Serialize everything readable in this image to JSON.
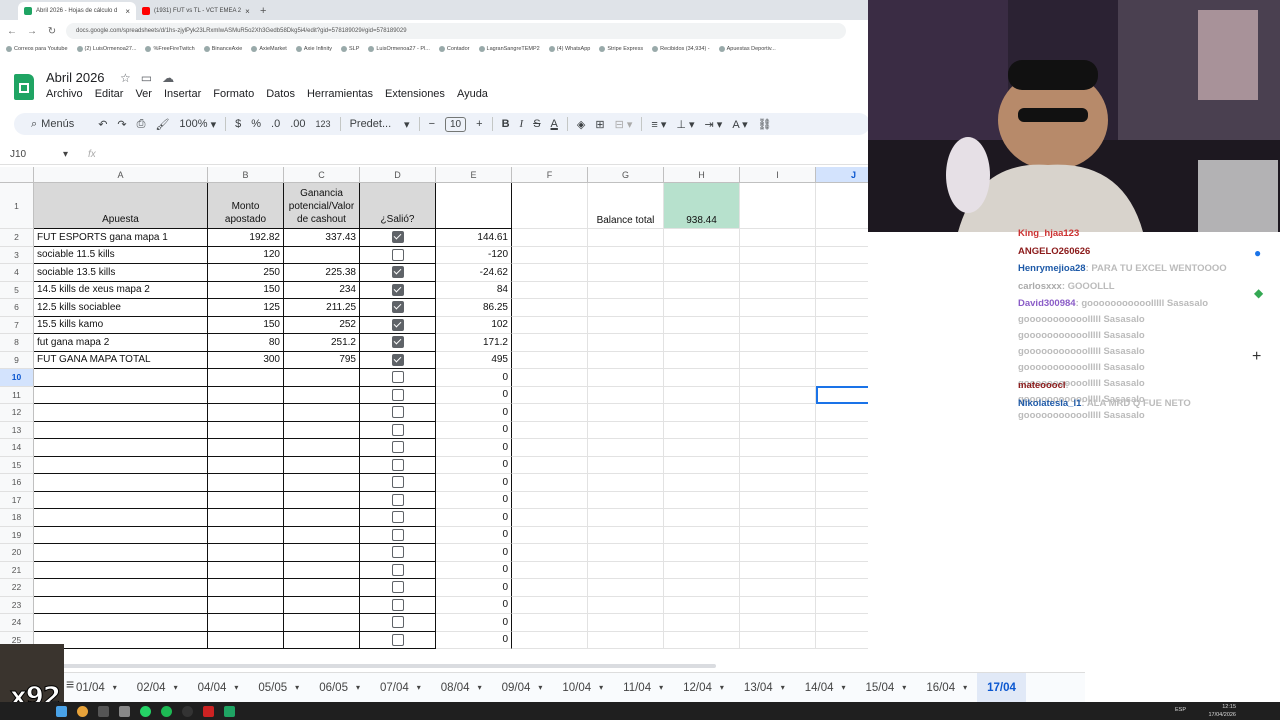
{
  "browser": {
    "tabs": [
      {
        "title": "Abril 2026 - Hojas de cálculo d",
        "active": true,
        "color": "#1fa463"
      },
      {
        "title": "(1931) FUT vs TL - VCT EMEA 2",
        "active": false,
        "color": "#ff0000"
      }
    ],
    "url": "docs.google.com/spreadsheets/d/1hs-zjylPyk23LRxmlwASMuR5o2Xh3Gedb58Dkg5i4/edit?gid=578189029#gid=578189029",
    "bookmarks": [
      "Correos para Youtube",
      "(2) LuisOrmenoa27...",
      "%FreeFireTwitch",
      "BinanceAxie",
      "AxieMarket",
      "Axie Infinity",
      "SLP",
      "LuisOrmenoa27 - Pl...",
      "Contador",
      "LagranSangreTEMP2",
      "(4) WhatsApp",
      "Stripe Express",
      "Recibidos (34,934) -",
      "Apuestas Deportiv..."
    ]
  },
  "doc": {
    "title": "Abril 2026",
    "menu": [
      "Archivo",
      "Editar",
      "Ver",
      "Insertar",
      "Formato",
      "Datos",
      "Herramientas",
      "Extensiones",
      "Ayuda"
    ]
  },
  "toolbar": {
    "search": "Menús",
    "zoom": "100%",
    "currency": "$",
    "percent": "%",
    "dec_less": ".0",
    "dec_more": ".00",
    "number_format": "123",
    "font": "Predet...",
    "font_size": "10",
    "bold": "B",
    "italic": "I",
    "strike": "S",
    "text_color": "A"
  },
  "formula_bar": {
    "name_box": "J10",
    "fx": "fx"
  },
  "columns": [
    "A",
    "B",
    "C",
    "D",
    "E",
    "F",
    "G",
    "H",
    "I",
    "J"
  ],
  "selected_column": "J",
  "headers": {
    "A": "Apuesta",
    "B": "Monto apostado",
    "C": "Ganancia potencial/Valor de cashout",
    "D": "¿Salió?"
  },
  "balance": {
    "label": "Balance total",
    "value": "938.44",
    "color": "#b7e1cd"
  },
  "row_numbers": [
    "1",
    "2",
    "3",
    "4",
    "5",
    "6",
    "7",
    "8",
    "9",
    "10",
    "11",
    "12",
    "13",
    "14",
    "15",
    "16",
    "17",
    "18",
    "19",
    "20",
    "21",
    "22",
    "23",
    "24",
    "25"
  ],
  "selected_row": "10",
  "rows": [
    {
      "apuesta": "FUT ESPORTS gana mapa 1",
      "monto": "192.82",
      "ganancia": "337.43",
      "salio": true,
      "resultado": "144.61"
    },
    {
      "apuesta": "sociable 11.5 kills",
      "monto": "120",
      "ganancia": "",
      "salio": false,
      "resultado": "-120"
    },
    {
      "apuesta": "sociable 13.5 kills",
      "monto": "250",
      "ganancia": "225.38",
      "salio": true,
      "resultado": "-24.62"
    },
    {
      "apuesta": "14.5 kills de xeus mapa 2",
      "monto": "150",
      "ganancia": "234",
      "salio": true,
      "resultado": "84"
    },
    {
      "apuesta": "12.5 kills sociablee",
      "monto": "125",
      "ganancia": "211.25",
      "salio": true,
      "resultado": "86.25"
    },
    {
      "apuesta": "15.5 kills kamo",
      "monto": "150",
      "ganancia": "252",
      "salio": true,
      "resultado": "102"
    },
    {
      "apuesta": "fut gana mapa 2",
      "monto": "80",
      "ganancia": "251.2",
      "salio": true,
      "resultado": "171.2"
    },
    {
      "apuesta": "FUT GANA MAPA TOTAL",
      "monto": "300",
      "ganancia": "795",
      "salio": true,
      "resultado": "495"
    },
    {
      "apuesta": "",
      "monto": "",
      "ganancia": "",
      "salio": false,
      "resultado": "0"
    },
    {
      "apuesta": "",
      "monto": "",
      "ganancia": "",
      "salio": false,
      "resultado": "0"
    },
    {
      "apuesta": "",
      "monto": "",
      "ganancia": "",
      "salio": false,
      "resultado": "0"
    },
    {
      "apuesta": "",
      "monto": "",
      "ganancia": "",
      "salio": false,
      "resultado": "0"
    },
    {
      "apuesta": "",
      "monto": "",
      "ganancia": "",
      "salio": false,
      "resultado": "0"
    },
    {
      "apuesta": "",
      "monto": "",
      "ganancia": "",
      "salio": false,
      "resultado": "0"
    },
    {
      "apuesta": "",
      "monto": "",
      "ganancia": "",
      "salio": false,
      "resultado": "0"
    },
    {
      "apuesta": "",
      "monto": "",
      "ganancia": "",
      "salio": false,
      "resultado": "0"
    },
    {
      "apuesta": "",
      "monto": "",
      "ganancia": "",
      "salio": false,
      "resultado": "0"
    },
    {
      "apuesta": "",
      "monto": "",
      "ganancia": "",
      "salio": false,
      "resultado": "0"
    },
    {
      "apuesta": "",
      "monto": "",
      "ganancia": "",
      "salio": false,
      "resultado": "0"
    },
    {
      "apuesta": "",
      "monto": "",
      "ganancia": "",
      "salio": false,
      "resultado": "0"
    },
    {
      "apuesta": "",
      "monto": "",
      "ganancia": "",
      "salio": false,
      "resultado": "0"
    },
    {
      "apuesta": "",
      "monto": "",
      "ganancia": "",
      "salio": false,
      "resultado": "0"
    },
    {
      "apuesta": "",
      "monto": "",
      "ganancia": "",
      "salio": false,
      "resultado": "0"
    },
    {
      "apuesta": "",
      "monto": "",
      "ganancia": "",
      "salio": false,
      "resultado": "0"
    }
  ],
  "sheet_tabs": [
    "01/04",
    "02/04",
    "04/04",
    "05/05",
    "06/05",
    "07/04",
    "08/04",
    "09/04",
    "10/04",
    "11/04",
    "12/04",
    "13/04",
    "14/04",
    "15/04",
    "16/04",
    "17/04"
  ],
  "active_sheet": "17/04",
  "chat": [
    {
      "user": "King_hjaa123",
      "msg": "",
      "color": "#cc3333"
    },
    {
      "user": "ANGELO260626",
      "msg": "",
      "color": "#8b1a1a"
    },
    {
      "user": "Henrymejioa28",
      "msg": ": PARA TU EXCEL WENTOOOO",
      "color": "#1e5aa8"
    },
    {
      "user": "carlosxxx",
      "msg": ": GOOOLLL",
      "color": "#aaaaaa"
    },
    {
      "user": "David300984",
      "msg": ": gooooooooooolllll Sasasalo gooooooooooolllll Sasasalo gooooooooooolllll Sasasalo gooooooooooolllll Sasasalo gooooooooooolllll Sasasalo gooooooooooolllll Sasasalo gooooooooooolllll Sasasalo gooooooooooolllll Sasasalo",
      "color": "#8a5cc7"
    },
    {
      "user": "mateooocl",
      "msg": ":",
      "color": "#8b1a1a"
    },
    {
      "user": "Nikolatesla_l1",
      "msg": ": ALA MRD Q FUE NETO",
      "color": "#1e5aa8"
    }
  ],
  "overlay": {
    "multiplier": "x92"
  },
  "clock": {
    "time": "12:15",
    "date": "17/04/2026",
    "lang": "ESP"
  }
}
